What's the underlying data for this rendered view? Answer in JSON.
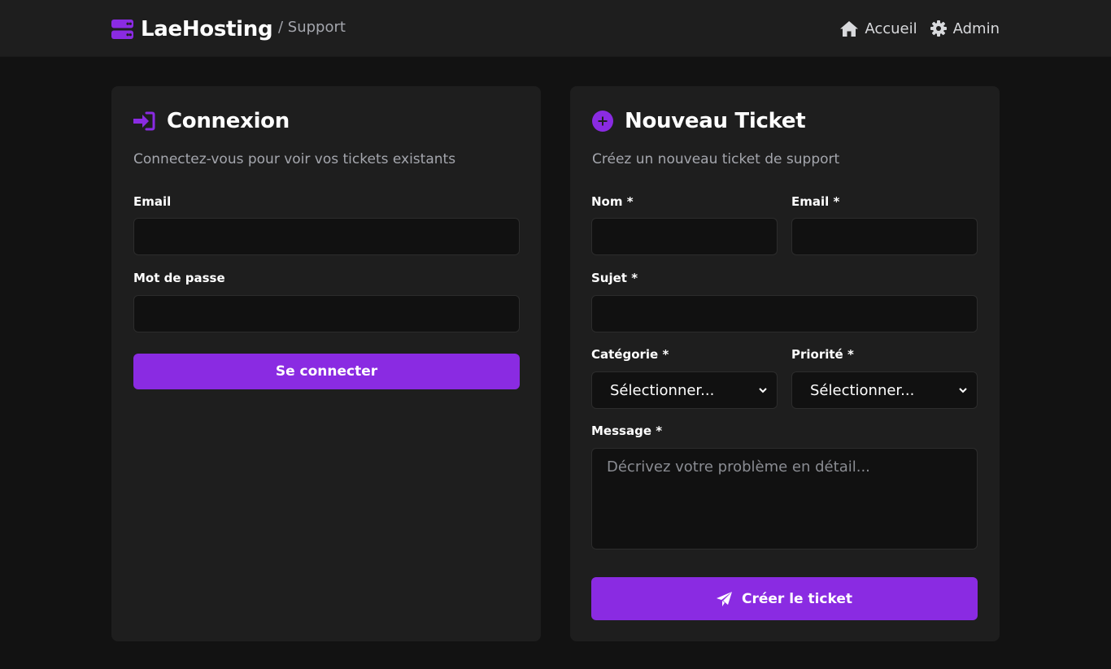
{
  "header": {
    "brand_name": "LaeHosting",
    "breadcrumb": "/ Support",
    "nav": [
      {
        "label": "Accueil",
        "icon": "home-icon"
      },
      {
        "label": "Admin",
        "icon": "gear-icon"
      }
    ]
  },
  "login": {
    "title": "Connexion",
    "title_icon": "sign-in-icon",
    "subtitle": "Connectez-vous pour voir vos tickets existants",
    "email_label": "Email",
    "email_value": "",
    "password_label": "Mot de passe",
    "password_value": "",
    "submit_label": "Se connecter"
  },
  "ticket": {
    "title": "Nouveau Ticket",
    "title_icon": "plus-circle-icon",
    "subtitle": "Créez un nouveau ticket de support",
    "name_label": "Nom *",
    "name_value": "",
    "email_label": "Email *",
    "email_value": "",
    "subject_label": "Sujet *",
    "subject_value": "",
    "category_label": "Catégorie *",
    "category_value": "Sélectionner...",
    "priority_label": "Priorité *",
    "priority_value": "Sélectionner...",
    "message_label": "Message *",
    "message_placeholder": "Décrivez votre problème en détail...",
    "submit_label": "Créer le ticket",
    "submit_icon": "paper-plane-icon"
  },
  "colors": {
    "accent": "#8a2be2",
    "page_bg": "#121212",
    "card_bg": "#1e1e1e",
    "input_bg": "#111111",
    "muted_text": "#a4a6ad"
  }
}
